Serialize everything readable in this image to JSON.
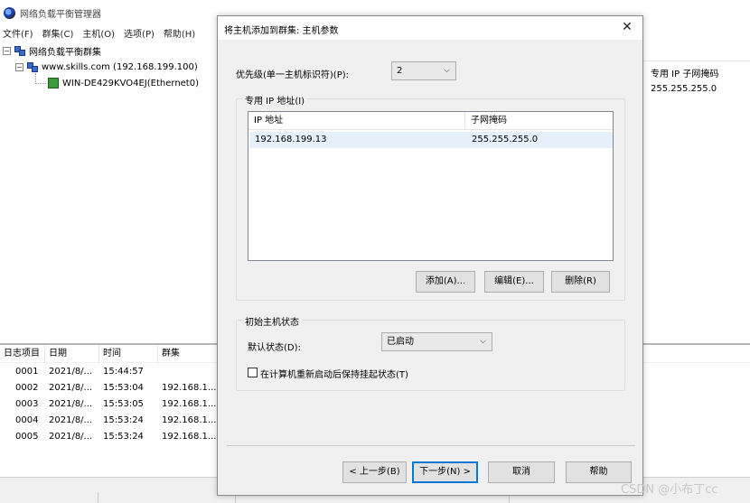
{
  "main_window": {
    "title": "网络负载平衡管理器",
    "menu": [
      "文件(F)",
      "群集(C)",
      "主机(O)",
      "选项(P)",
      "帮助(H)"
    ],
    "tree": {
      "root": "网络负载平衡群集",
      "cluster": "www.skills.com (192.168.199.100)",
      "host": "WIN-DE429KVO4EJ(Ethernet0)"
    },
    "right_panel": {
      "header": "专用 IP 子网掩码",
      "value": "255.255.255.0"
    },
    "log": {
      "columns": [
        "日志项目",
        "日期",
        "时间",
        "群集"
      ],
      "rows": [
        {
          "id": "0001",
          "date": "2021/8/...",
          "time": "15:44:57",
          "cluster": ""
        },
        {
          "id": "0002",
          "date": "2021/8/...",
          "time": "15:53:04",
          "cluster": "192.168.1..."
        },
        {
          "id": "0003",
          "date": "2021/8/...",
          "time": "15:53:05",
          "cluster": "192.168.1..."
        },
        {
          "id": "0004",
          "date": "2021/8/...",
          "time": "15:53:24",
          "cluster": "192.168.1..."
        },
        {
          "id": "0005",
          "date": "2021/8/...",
          "time": "15:53:24",
          "cluster": "192.168.1..."
        }
      ]
    }
  },
  "dialog": {
    "title": "将主机添加到群集: 主机参数",
    "close_glyph": "✕",
    "priority_label": "优先级(单一主机标识符)(P):",
    "priority_value": "2",
    "dedicated_ip_group": "专用 IP 地址(I)",
    "ip_table": {
      "columns": [
        "IP 地址",
        "子网掩码"
      ],
      "rows": [
        {
          "ip": "192.168.199.13",
          "mask": "255.255.255.0"
        }
      ]
    },
    "add_button": "添加(A)...",
    "edit_button": "编辑(E)...",
    "delete_button": "删除(R)",
    "initial_state_group": "初始主机状态",
    "default_state_label": "默认状态(D):",
    "default_state_value": "已启动",
    "persist_checkbox_label": "在计算机重新启动后保持挂起状态(T)",
    "persist_checked": false,
    "back_button": "< 上一步(B)",
    "next_button": "下一步(N) >",
    "cancel_button": "取消",
    "help_button": "帮助"
  },
  "watermark": "CSDN @小布丁cc"
}
